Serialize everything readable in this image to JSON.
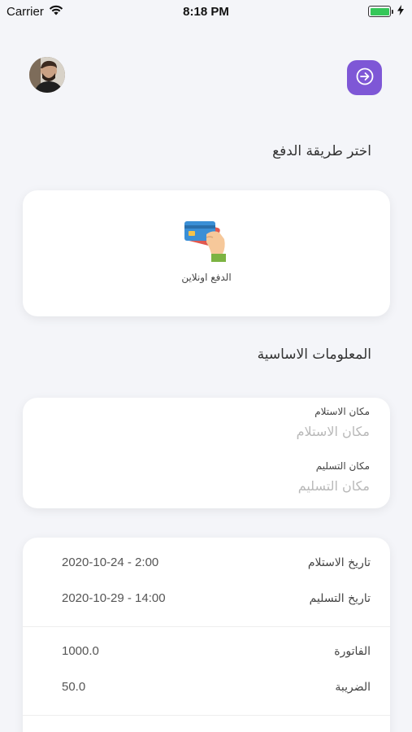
{
  "status_bar": {
    "carrier": "Carrier",
    "time": "8:18 PM"
  },
  "header": {
    "avatar_icon": "user-avatar",
    "next_icon": "arrow-right-icon",
    "accent_color": "#7e57d6"
  },
  "payment": {
    "title": "اختر طريقة الدفع",
    "option_label": "الدفع اونلاين",
    "option_icon": "card-in-hand-icon"
  },
  "basic_info": {
    "title": "المعلومات الاساسية",
    "pickup_label": "مكان الاستلام",
    "pickup_placeholder": "مكان الاستلام",
    "delivery_label": "مكان التسليم",
    "delivery_placeholder": "مكان التسليم"
  },
  "summary": {
    "pickup_date_label": "تاريخ الاستلام",
    "pickup_date_value": "2020-10-24 - 2:00",
    "delivery_date_label": "تاريخ التسليم",
    "delivery_date_value": "2020-10-29 - 14:00",
    "invoice_label": "الفاتورة",
    "invoice_value": "1000.0",
    "tax_label": "الضريبة",
    "tax_value": "50.0"
  }
}
